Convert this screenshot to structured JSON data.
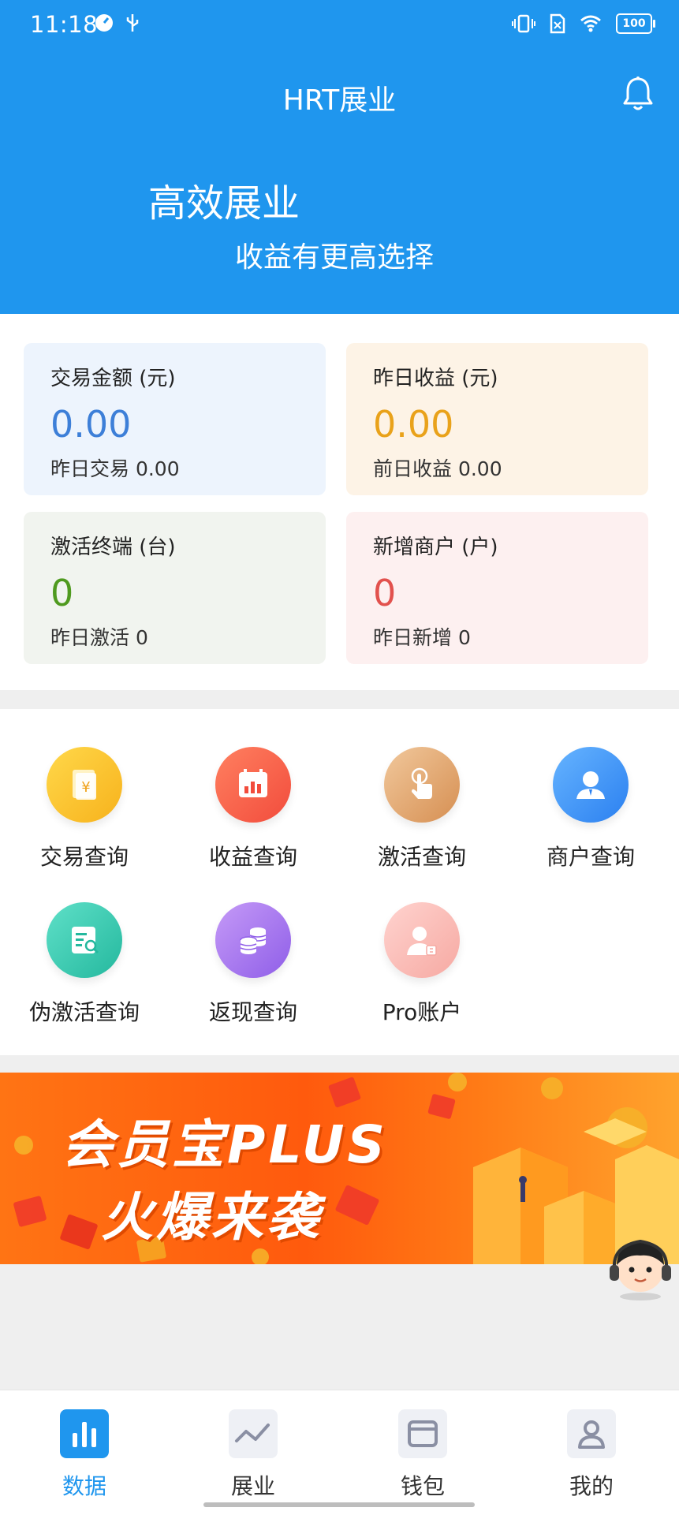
{
  "status_bar": {
    "time": "11:18",
    "battery": "100"
  },
  "header": {
    "title": "HRT展业",
    "hero_title": "高效展业",
    "hero_subtitle": "收益有更高选择"
  },
  "stats": [
    {
      "label": "交易金额 (元)",
      "value": "0.00",
      "footer": "昨日交易 0.00",
      "value_color": "#3d7fd8",
      "bg": "#edf4fd"
    },
    {
      "label": "昨日收益 (元)",
      "value": "0.00",
      "footer": "前日收益 0.00",
      "value_color": "#e9a21a",
      "bg": "#fdf3e6"
    },
    {
      "label": "激活终端 (台)",
      "value": "0",
      "footer": "昨日激活 0",
      "value_color": "#4f9a1f",
      "bg": "#f1f4ef"
    },
    {
      "label": "新增商户 (户)",
      "value": "0",
      "footer": "昨日新增 0",
      "value_color": "#e2514d",
      "bg": "#fdf0f0"
    }
  ],
  "quick_actions": [
    {
      "label": "交易查询",
      "icon": "yuan-document-icon"
    },
    {
      "label": "收益查询",
      "icon": "calendar-chart-icon"
    },
    {
      "label": "激活查询",
      "icon": "touch-hand-icon"
    },
    {
      "label": "商户查询",
      "icon": "merchant-person-icon"
    },
    {
      "label": "伪激活查询",
      "icon": "document-search-icon"
    },
    {
      "label": "返现查询",
      "icon": "coin-stack-icon"
    },
    {
      "label": "Pro账户",
      "icon": "pro-account-icon"
    }
  ],
  "banner": {
    "line1": "会员宝PLUS",
    "line2": "火爆来袭"
  },
  "tabs": [
    {
      "label": "数据",
      "active": true
    },
    {
      "label": "展业",
      "active": false
    },
    {
      "label": "钱包",
      "active": false
    },
    {
      "label": "我的",
      "active": false
    }
  ],
  "colors": {
    "brand": "#1f96ee",
    "active_tab": "#1f96ee"
  }
}
